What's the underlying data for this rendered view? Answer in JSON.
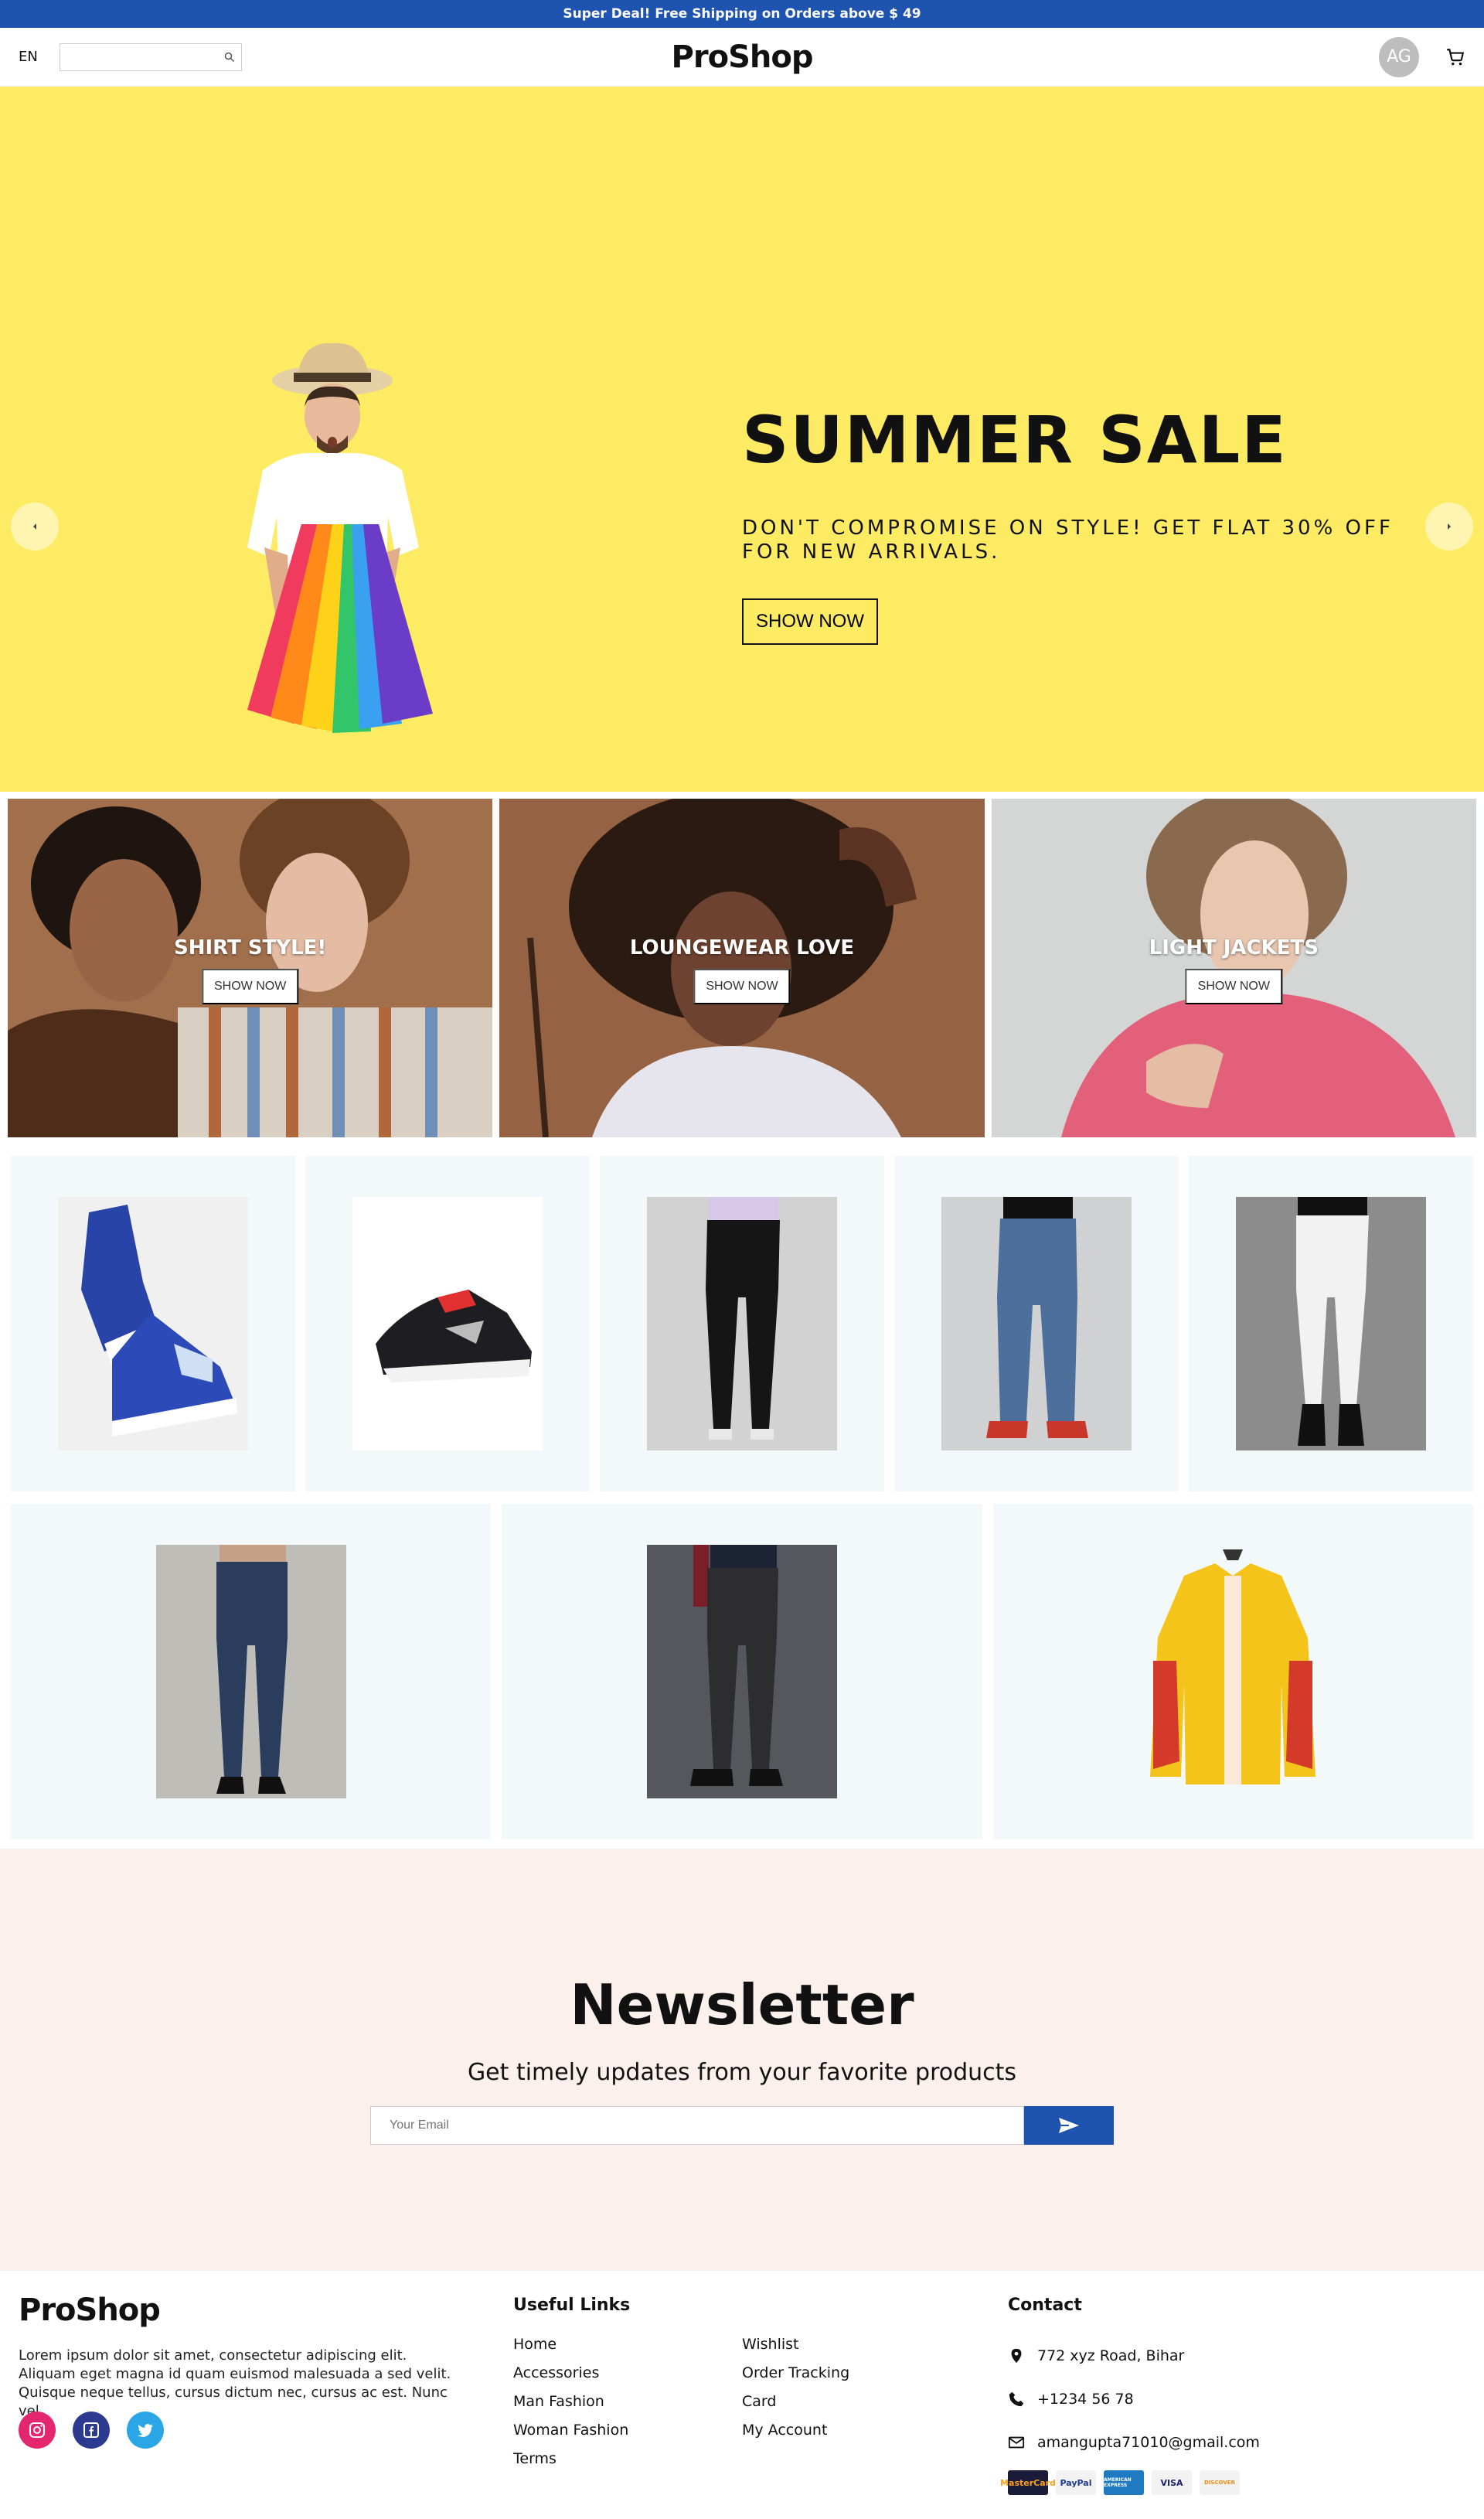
{
  "promo": {
    "text": "Super Deal! Free Shipping on Orders above $ 49"
  },
  "header": {
    "language": "EN",
    "search_placeholder": "",
    "logo": "ProShop",
    "avatar_initials": "AG",
    "icons": [
      "search-icon",
      "cart-icon"
    ]
  },
  "hero": {
    "title": "SUMMER SALE",
    "subtitle": "DON'T COMPROMISE ON STYLE! GET FLAT 30% OFF FOR NEW ARRIVALS.",
    "button": "SHOW NOW",
    "colors": {
      "background": "#fdec63"
    },
    "icons": [
      "arrow-left-icon",
      "arrow-right-icon"
    ]
  },
  "categories": [
    {
      "title": "SHIRT STYLE!",
      "button": "SHOW NOW"
    },
    {
      "title": "LOUNGEWEAR LOVE",
      "button": "SHOW NOW"
    },
    {
      "title": "LIGHT JACKETS",
      "button": "SHOW NOW"
    }
  ],
  "products": [
    {
      "name": "blue-high-top-sneakers"
    },
    {
      "name": "black-running-shoe"
    },
    {
      "name": "black-skinny-jeans"
    },
    {
      "name": "blue-mom-jeans"
    },
    {
      "name": "white-skinny-jeans"
    },
    {
      "name": "mens-blue-jeans"
    },
    {
      "name": "mens-charcoal-jeans"
    },
    {
      "name": "yellow-denim-jacket"
    }
  ],
  "newsletter": {
    "title": "Newsletter",
    "subtitle": "Get timely updates from your favorite products",
    "placeholder": "Your Email",
    "icon": "send-icon"
  },
  "footer": {
    "logo": "ProShop",
    "description": "Lorem ipsum dolor sit amet, consectetur adipiscing elit. Aliquam eget magna id quam euismod malesuada a sed velit. Quisque neque tellus, cursus dictum nec, cursus ac est. Nunc vel",
    "socials": [
      "instagram-icon",
      "facebook-icon",
      "twitter-icon"
    ],
    "useful_links_title": "Useful Links",
    "links_col1": [
      "Home",
      "Accessories",
      "Man Fashion",
      "Woman Fashion",
      "Terms"
    ],
    "links_col2": [
      "Wishlist",
      "Order Tracking",
      "Card",
      "My Account"
    ],
    "contact_title": "Contact",
    "address": "772 xyz Road, Bihar",
    "phone": "+1234 56 78",
    "email": "amangupta71010@gmail.com",
    "payments": [
      "MasterCard",
      "PayPal",
      "AMERICAN EXPRESS",
      "VISA",
      "DISCOVER"
    ]
  },
  "colors": {
    "accent": "#1e53b0",
    "newsletter_bg": "#fbf0ec",
    "card_bg": "#f3f8fb"
  }
}
